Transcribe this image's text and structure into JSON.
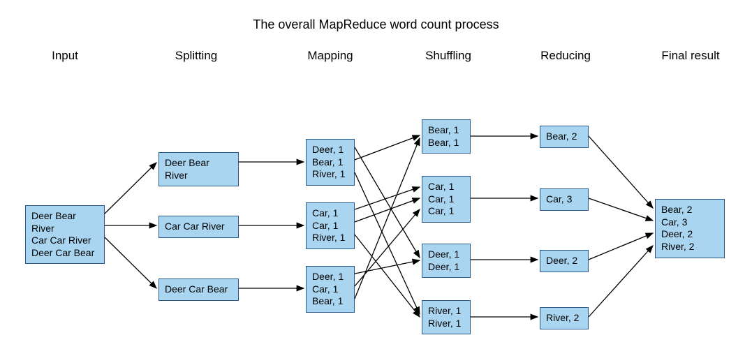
{
  "title": "The overall MapReduce word count process",
  "stages": {
    "input": "Input",
    "splitting": "Splitting",
    "mapping": "Mapping",
    "shuffling": "Shuffling",
    "reducing": "Reducing",
    "final": "Final result"
  },
  "input": {
    "line1": "Deer Bear River",
    "line2": "Car Car River",
    "line3": "Deer Car Bear"
  },
  "split": {
    "s1": "Deer Bear River",
    "s2": "Car Car River",
    "s3": "Deer Car Bear"
  },
  "map": {
    "m1": {
      "a": "Deer, 1",
      "b": "Bear, 1",
      "c": "River, 1"
    },
    "m2": {
      "a": "Car, 1",
      "b": "Car, 1",
      "c": "River, 1"
    },
    "m3": {
      "a": "Deer, 1",
      "b": "Car, 1",
      "c": "Bear, 1"
    }
  },
  "shuffle": {
    "bear": {
      "a": "Bear, 1",
      "b": "Bear, 1"
    },
    "car": {
      "a": "Car, 1",
      "b": "Car, 1",
      "c": "Car, 1"
    },
    "deer": {
      "a": "Deer, 1",
      "b": "Deer, 1"
    },
    "river": {
      "a": "River, 1",
      "b": "River, 1"
    }
  },
  "reduce": {
    "bear": "Bear, 2",
    "car": "Car, 3",
    "deer": "Deer, 2",
    "river": "River, 2"
  },
  "final": {
    "a": "Bear, 2",
    "b": "Car, 3",
    "c": "Deer, 2",
    "d": "River, 2"
  }
}
